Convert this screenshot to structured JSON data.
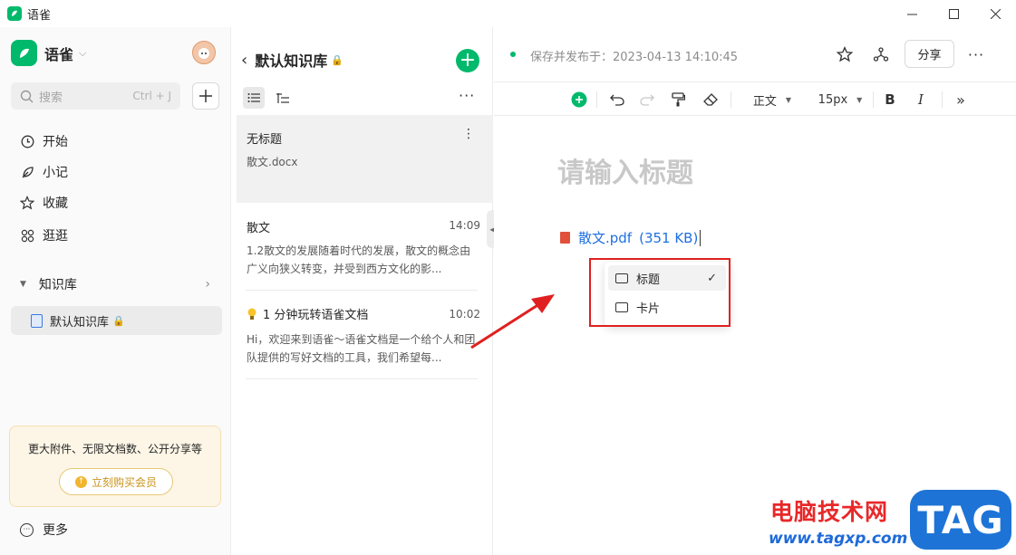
{
  "window": {
    "title": "语雀",
    "controls": [
      "minimize-icon",
      "maximize-icon",
      "close-icon"
    ]
  },
  "sidebar": {
    "brand": "语雀",
    "search": {
      "placeholder": "搜索",
      "shortcut": "Ctrl + J"
    },
    "nav": [
      {
        "label": "开始",
        "icon": "clock-icon"
      },
      {
        "label": "小记",
        "icon": "feather-icon"
      },
      {
        "label": "收藏",
        "icon": "star-icon"
      },
      {
        "label": "逛逛",
        "icon": "grid-icon"
      }
    ],
    "knowledge_section": "知识库",
    "knowledge_base": {
      "label": "默认知识库"
    },
    "promo": {
      "text": "更大附件、无限文档数、公开分享等",
      "button": "立刻购买会员"
    },
    "more": "更多"
  },
  "doclist": {
    "title": "默认知识库",
    "docs": [
      {
        "title": "无标题",
        "time": "",
        "snippet": "散文.docx"
      },
      {
        "title": "散文",
        "time": "14:09",
        "snippet": "1.2散文的发展随着时代的发展，散文的概念由广义向狭义转变，并受到西方文化的影..."
      },
      {
        "title": "1 分钟玩转语雀文档",
        "time": "10:02",
        "snippet": "Hi，欢迎来到语雀～语雀文档是一个给个人和团队提供的写好文档的工具，我们希望每..."
      }
    ]
  },
  "editor": {
    "save_status": "保存并发布于：2023-04-13 14:10:45",
    "share": "分享",
    "toolbar": {
      "style": "正文",
      "font_size": "15px",
      "bold": "B",
      "italic": "I"
    },
    "title_placeholder": "请输入标题",
    "attachment": {
      "name": "散文.pdf",
      "size": "(351 KB)"
    },
    "display_menu": [
      {
        "label": "标题",
        "selected": true
      },
      {
        "label": "卡片",
        "selected": false
      }
    ]
  },
  "watermark": {
    "site_name": "电脑技术网",
    "url": "www.tagxp.com",
    "badge": "TAG"
  },
  "colors": {
    "accent": "#00b96b",
    "link": "#1f6fe0",
    "annotation": "#e02020"
  }
}
